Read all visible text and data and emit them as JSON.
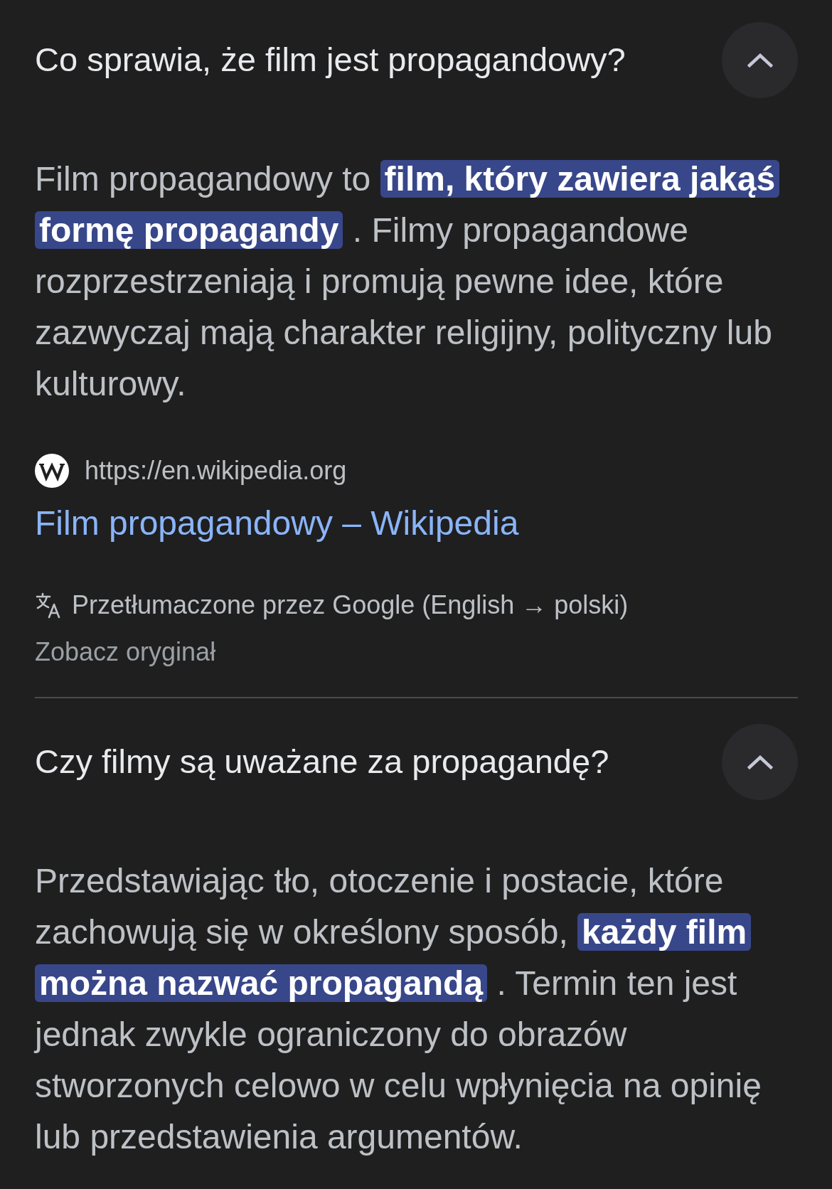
{
  "faq": [
    {
      "question": "Co sprawia, że film jest propagandowy?",
      "expanded": true,
      "answer": "Film propagandowy to **film, który zawiera jakąś formę propagandy** . Filmy propagandowe rozprzestrzeniają i promują pewne idee, które zazwyczaj mają charakter religijny, polityczny lub kulturowy.",
      "source": {
        "url": "https://en.wikipedia.org",
        "title": "Film propagandowy – Wikipedia"
      },
      "translation": {
        "note": "Przetłumaczone przez Google (English → polski)",
        "link": "Zobacz oryginał"
      }
    },
    {
      "question": "Czy filmy są uważane za propagandę?",
      "expanded": true,
      "answer": "Przedstawiając tło, otoczenie i postacie, które zachowują się w określony sposób, **każdy film można nazwać propagandą** . Termin ten jest jednak zwykle ograniczony do obrazów stworzonych celowo w celu wpłynięcia na opinię lub przedstawienia argumentów."
    }
  ]
}
